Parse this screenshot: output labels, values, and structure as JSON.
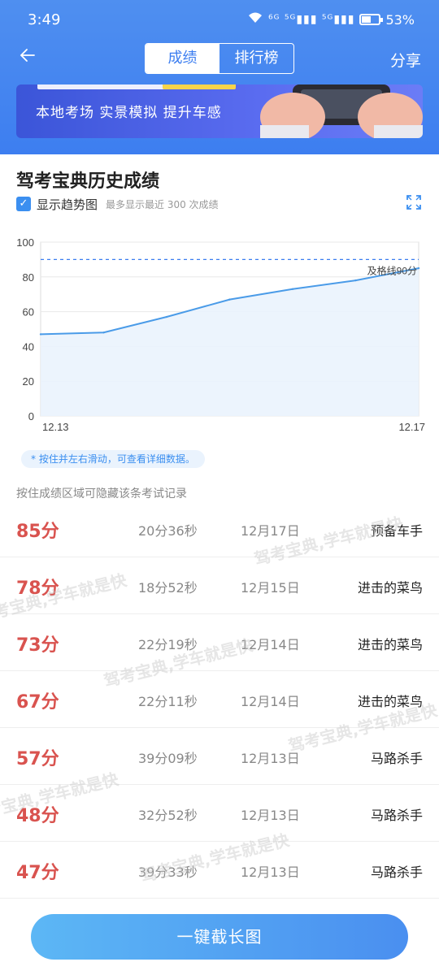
{
  "statusbar": {
    "time": "3:49",
    "signal": "⁶ᴳ ⁵ᴳ▮▮▮ ⁵ᴳ▮▮▮",
    "battery_text": "53%",
    "battery_level": 0.53
  },
  "navbar": {
    "back_icon": "back-arrow-icon",
    "tabs": [
      {
        "label": "成绩",
        "active": true
      },
      {
        "label": "排行榜",
        "active": false
      }
    ],
    "share_label": "分享"
  },
  "banner": {
    "text": "本地考场  实景模拟  提升车感"
  },
  "section": {
    "title": "驾考宝典历史成绩",
    "trend_label": "显示趋势图",
    "trend_note": "最多显示最近 300 次成绩",
    "trend_checked": true
  },
  "chart_data": {
    "type": "area",
    "x": [
      "12.13",
      "12.13",
      "12.13",
      "12.14",
      "12.14",
      "12.15",
      "12.17"
    ],
    "values": [
      47,
      48,
      57,
      67,
      73,
      78,
      85
    ],
    "x_tick_labels": [
      "12.13",
      "12.17"
    ],
    "y_ticks": [
      0,
      20,
      40,
      60,
      80,
      100
    ],
    "ylim": [
      0,
      100
    ],
    "reference_line": {
      "value": 90,
      "label": "及格线90分"
    },
    "grid": true,
    "line_color": "#4a9be8",
    "ref_color": "#3b7df0"
  },
  "hint_pill": "* 按住并左右滑动，可查看详细数据。",
  "sub_hint": "按住成绩区域可隐藏该条考试记录",
  "records": [
    {
      "score": "85分",
      "duration": "20分36秒",
      "date": "12月17日",
      "rank": "预备车手"
    },
    {
      "score": "78分",
      "duration": "18分52秒",
      "date": "12月15日",
      "rank": "进击的菜鸟"
    },
    {
      "score": "73分",
      "duration": "22分19秒",
      "date": "12月14日",
      "rank": "进击的菜鸟"
    },
    {
      "score": "67分",
      "duration": "22分11秒",
      "date": "12月14日",
      "rank": "进击的菜鸟"
    },
    {
      "score": "57分",
      "duration": "39分09秒",
      "date": "12月13日",
      "rank": "马路杀手"
    },
    {
      "score": "48分",
      "duration": "32分52秒",
      "date": "12月13日",
      "rank": "马路杀手"
    },
    {
      "score": "47分",
      "duration": "39分33秒",
      "date": "12月13日",
      "rank": "马路杀手"
    }
  ],
  "watermark": "驾考宝典,学车就是快",
  "cta_label": "一键截长图",
  "colors": {
    "accent": "#3b7df0",
    "score": "#d9534f"
  }
}
